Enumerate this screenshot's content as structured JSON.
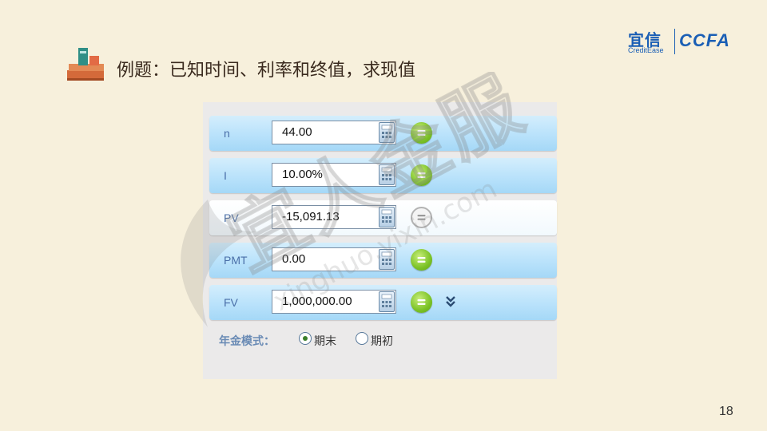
{
  "slide": {
    "title": "例题：已知时间、利率和终值，求现值",
    "page_number": "18"
  },
  "logo": {
    "brand_cn": "宜信",
    "brand_en": "CreditEase",
    "partner": "CCFA"
  },
  "watermark": {
    "text_cn": "宜人金服",
    "text_url": "xinghuo.yixin.com"
  },
  "calculator": {
    "rows": [
      {
        "label": "n",
        "value": "44.00",
        "computed": true
      },
      {
        "label": "I",
        "value": "10.00%",
        "computed": true
      },
      {
        "label": "PV",
        "value": "-15,091.13",
        "computed": false
      },
      {
        "label": "PMT",
        "value": "0.00",
        "computed": true
      },
      {
        "label": "FV",
        "value": "1,000,000.00",
        "computed": true
      }
    ],
    "annuity_mode": {
      "label": "年金模式：",
      "options": [
        "期末",
        "期初"
      ],
      "selected": "期末"
    }
  },
  "icons": {
    "title_icon": "books-icon",
    "calc_icon": "calculator-icon",
    "equals_icon": "equals-icon",
    "expand_icon": "chevron-double-down-icon"
  },
  "colors": {
    "background": "#f7f0dc",
    "row_blue": "#b9e2fb",
    "equals_green": "#7bc226",
    "brand_blue": "#1b5fb5"
  }
}
